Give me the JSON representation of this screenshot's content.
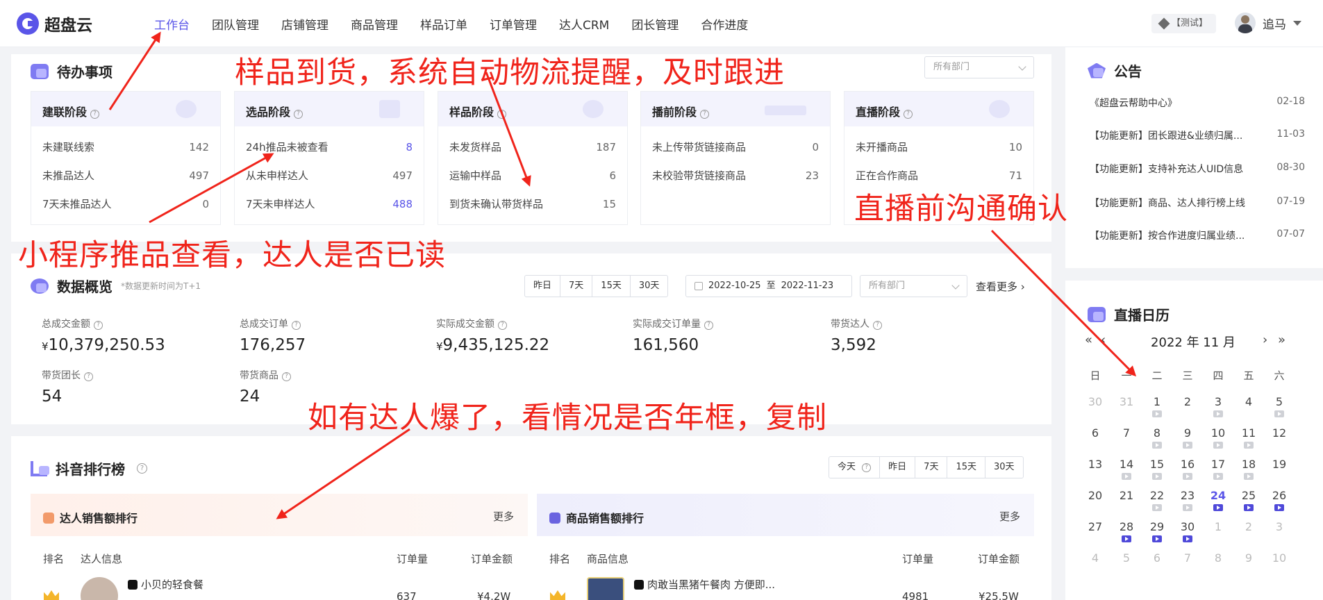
{
  "brand": {
    "name": "超盘云"
  },
  "nav": [
    "工作台",
    "团队管理",
    "店铺管理",
    "商品管理",
    "样品订单",
    "订单管理",
    "达人CRM",
    "团长管理",
    "合作进度"
  ],
  "header": {
    "env": "【测试】",
    "user": "追马"
  },
  "todo": {
    "title": "待办事项",
    "dept_placeholder": "所有部门",
    "stages": [
      {
        "title": "建联阶段",
        "rows": [
          {
            "label": "未建联线索",
            "value": "142"
          },
          {
            "label": "未推品达人",
            "value": "497"
          },
          {
            "label": "7天未推品达人",
            "value": "0"
          }
        ]
      },
      {
        "title": "选品阶段",
        "rows": [
          {
            "label": "24h推品未被查看",
            "value": "8"
          },
          {
            "label": "从未申样达人",
            "value": "497"
          },
          {
            "label": "7天未申样达人",
            "value": "488"
          }
        ]
      },
      {
        "title": "样品阶段",
        "rows": [
          {
            "label": "未发货样品",
            "value": "187"
          },
          {
            "label": "运输中样品",
            "value": "6"
          },
          {
            "label": "到货未确认带货样品",
            "value": "15"
          }
        ]
      },
      {
        "title": "播前阶段",
        "rows": [
          {
            "label": "未上传带货链接商品",
            "value": "0"
          },
          {
            "label": "未校验带货链接商品",
            "value": "23"
          }
        ]
      },
      {
        "title": "直播阶段",
        "rows": [
          {
            "label": "未开播商品",
            "value": "10"
          },
          {
            "label": "正在合作商品",
            "value": "71"
          }
        ]
      }
    ]
  },
  "overview": {
    "title": "数据概览",
    "note": "*数据更新时间为T+1",
    "ranges": [
      "昨日",
      "7天",
      "15天",
      "30天"
    ],
    "date_from": "2022-10-25",
    "date_sep": "至",
    "date_to": "2022-11-23",
    "dept_placeholder": "所有部门",
    "view_more": "查看更多",
    "metrics": [
      {
        "label": "总成交金额",
        "value": "10,379,250.53",
        "currency": "¥"
      },
      {
        "label": "总成交订单",
        "value": "176,257",
        "currency": ""
      },
      {
        "label": "实际成交金额",
        "value": "9,435,125.22",
        "currency": "¥"
      },
      {
        "label": "实际成交订单量",
        "value": "161,560",
        "currency": ""
      },
      {
        "label": "带货达人",
        "value": "3,592",
        "currency": ""
      },
      {
        "label": "带货团长",
        "value": "54",
        "currency": ""
      },
      {
        "label": "带货商品",
        "value": "24",
        "currency": ""
      }
    ]
  },
  "ranking": {
    "title": "抖音排行榜",
    "ranges": [
      "今天",
      "昨日",
      "7天",
      "15天",
      "30天"
    ],
    "influencer": {
      "title": "达人销售额排行",
      "more": "更多",
      "cols": [
        "排名",
        "达人信息",
        "订单量",
        "订单金额"
      ],
      "row": {
        "name": "小贝的轻食餐",
        "orders": "637",
        "amount": "¥4.2W"
      }
    },
    "product": {
      "title": "商品销售额排行",
      "more": "更多",
      "cols": [
        "排名",
        "商品信息",
        "订单量",
        "订单金额"
      ],
      "row": {
        "name": "肉敢当黑猪午餐肉 方便即...",
        "orders": "4981",
        "amount": "¥25.5W"
      }
    }
  },
  "notice": {
    "title": "公告",
    "items": [
      {
        "text": "《超盘云帮助中心》",
        "date": "02-18"
      },
      {
        "text": "【功能更新】团长跟进&业绩归属...",
        "date": "11-03"
      },
      {
        "text": "【功能更新】支持补充达人UID信息",
        "date": "08-30"
      },
      {
        "text": "【功能更新】商品、达人排行榜上线",
        "date": "07-19"
      },
      {
        "text": "【功能更新】按合作进度归属业绩...",
        "date": "07-07"
      }
    ]
  },
  "calendar": {
    "title": "直播日历",
    "month_label": "2022 年 11 月",
    "weekdays": [
      "日",
      "一",
      "二",
      "三",
      "四",
      "五",
      "六"
    ],
    "today": 24,
    "weeks": [
      [
        {
          "d": "30",
          "m": "prev"
        },
        {
          "d": "31",
          "m": "prev"
        },
        {
          "d": "1",
          "v": "grey"
        },
        {
          "d": "2"
        },
        {
          "d": "3",
          "v": "grey"
        },
        {
          "d": "4"
        },
        {
          "d": "5",
          "v": "grey"
        }
      ],
      [
        {
          "d": "6"
        },
        {
          "d": "7"
        },
        {
          "d": "8",
          "v": "grey"
        },
        {
          "d": "9",
          "v": "grey"
        },
        {
          "d": "10",
          "v": "grey"
        },
        {
          "d": "11",
          "v": "grey"
        },
        {
          "d": "12"
        }
      ],
      [
        {
          "d": "13"
        },
        {
          "d": "14",
          "v": "grey"
        },
        {
          "d": "15",
          "v": "grey"
        },
        {
          "d": "16",
          "v": "grey"
        },
        {
          "d": "17",
          "v": "grey"
        },
        {
          "d": "18",
          "v": "grey"
        },
        {
          "d": "19"
        }
      ],
      [
        {
          "d": "20"
        },
        {
          "d": "21"
        },
        {
          "d": "22",
          "v": "grey"
        },
        {
          "d": "23",
          "v": "grey"
        },
        {
          "d": "24",
          "v": "on"
        },
        {
          "d": "25",
          "v": "on"
        },
        {
          "d": "26",
          "v": "on"
        }
      ],
      [
        {
          "d": "27"
        },
        {
          "d": "28",
          "v": "on"
        },
        {
          "d": "29",
          "v": "on"
        },
        {
          "d": "30",
          "v": "on"
        },
        {
          "d": "1",
          "m": "next"
        },
        {
          "d": "2",
          "m": "next"
        },
        {
          "d": "3",
          "m": "next"
        }
      ],
      [
        {
          "d": "4",
          "m": "next"
        },
        {
          "d": "5",
          "m": "next"
        },
        {
          "d": "6",
          "m": "next"
        },
        {
          "d": "7",
          "m": "next"
        },
        {
          "d": "8",
          "m": "next"
        },
        {
          "d": "9",
          "m": "next"
        },
        {
          "d": "10",
          "m": "next"
        }
      ]
    ]
  },
  "annotations": {
    "sample": "样品到货，系统自动物流提醒，及时跟进",
    "miniapp": "小程序推品查看，达人是否已读",
    "live": "直播前沟通确认",
    "viral": "如有达人爆了，看情况是否年框，复制"
  },
  "colors": {
    "accent": "#5a55e8",
    "annotation": "#f0241b"
  }
}
